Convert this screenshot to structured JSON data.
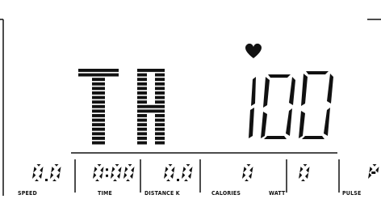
{
  "display": {
    "heart_icon": "heart-icon",
    "main_text": "TA",
    "main_value": "100",
    "readouts": [
      {
        "value": "0.0",
        "label": "SPEED"
      },
      {
        "value": "0:00",
        "label": "TIME"
      },
      {
        "value": "0.0",
        "label": "DISTANCE  K"
      },
      {
        "value": "0",
        "label": "CALORIES"
      },
      {
        "value": "0",
        "label": "WATT"
      },
      {
        "value": "P",
        "label": "PULSE"
      }
    ],
    "colors": {
      "segment": "#111111",
      "background": "#ffffff"
    }
  }
}
